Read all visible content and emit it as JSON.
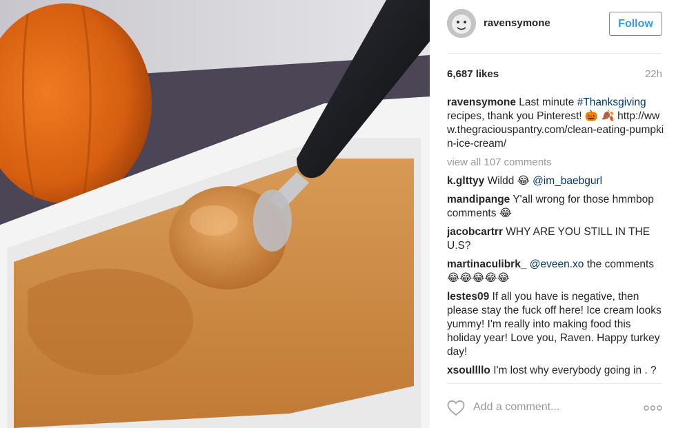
{
  "post": {
    "username": "ravensymone",
    "follow_label": "Follow",
    "likes": "6,687 likes",
    "time_ago": "22h",
    "caption": {
      "author": "ravensymone",
      "text_before": "Last minute ",
      "hashtag": "#Thanksgiving",
      "text_after": " recipes, thank you Pinterest! 🎃 🍂 ",
      "url": "http://www.thegraciouspantry.com/clean-eating-pumpkin-ice-cream/"
    },
    "view_all": "view all 107 comments",
    "comments": [
      {
        "author": "k.glttyy",
        "before": "Wildd 😂 ",
        "mention": "@im_baebgurl",
        "after": ""
      },
      {
        "author": "mandipange",
        "before": "Y'all wrong for those hmmbop comments 😂",
        "mention": "",
        "after": ""
      },
      {
        "author": "jacobcartrr",
        "before": "WHY ARE YOU STILL IN THE U.S?",
        "mention": "",
        "after": ""
      },
      {
        "author": "martinaculibrk_",
        "before": "",
        "mention": "@eveen.xo",
        "after": " the comments 😂😂😂😂😂"
      },
      {
        "author": "lestes09",
        "before": "If all you have is negative, then please stay the fuck off here! Ice cream looks yummy! I'm really into making food this holiday year! Love you, Raven. Happy turkey day!",
        "mention": "",
        "after": ""
      },
      {
        "author": "xsoullllo",
        "before": "I'm lost why everybody going in . ?",
        "mention": "",
        "after": ""
      }
    ],
    "add_comment_placeholder": "Add a comment..."
  },
  "icons": {
    "heart": "heart-icon",
    "more": "more-options-icon",
    "avatar": "avatar"
  },
  "colors": {
    "accent": "#3897f0",
    "hashtag": "#003569",
    "muted": "#999999",
    "text": "#262626"
  }
}
